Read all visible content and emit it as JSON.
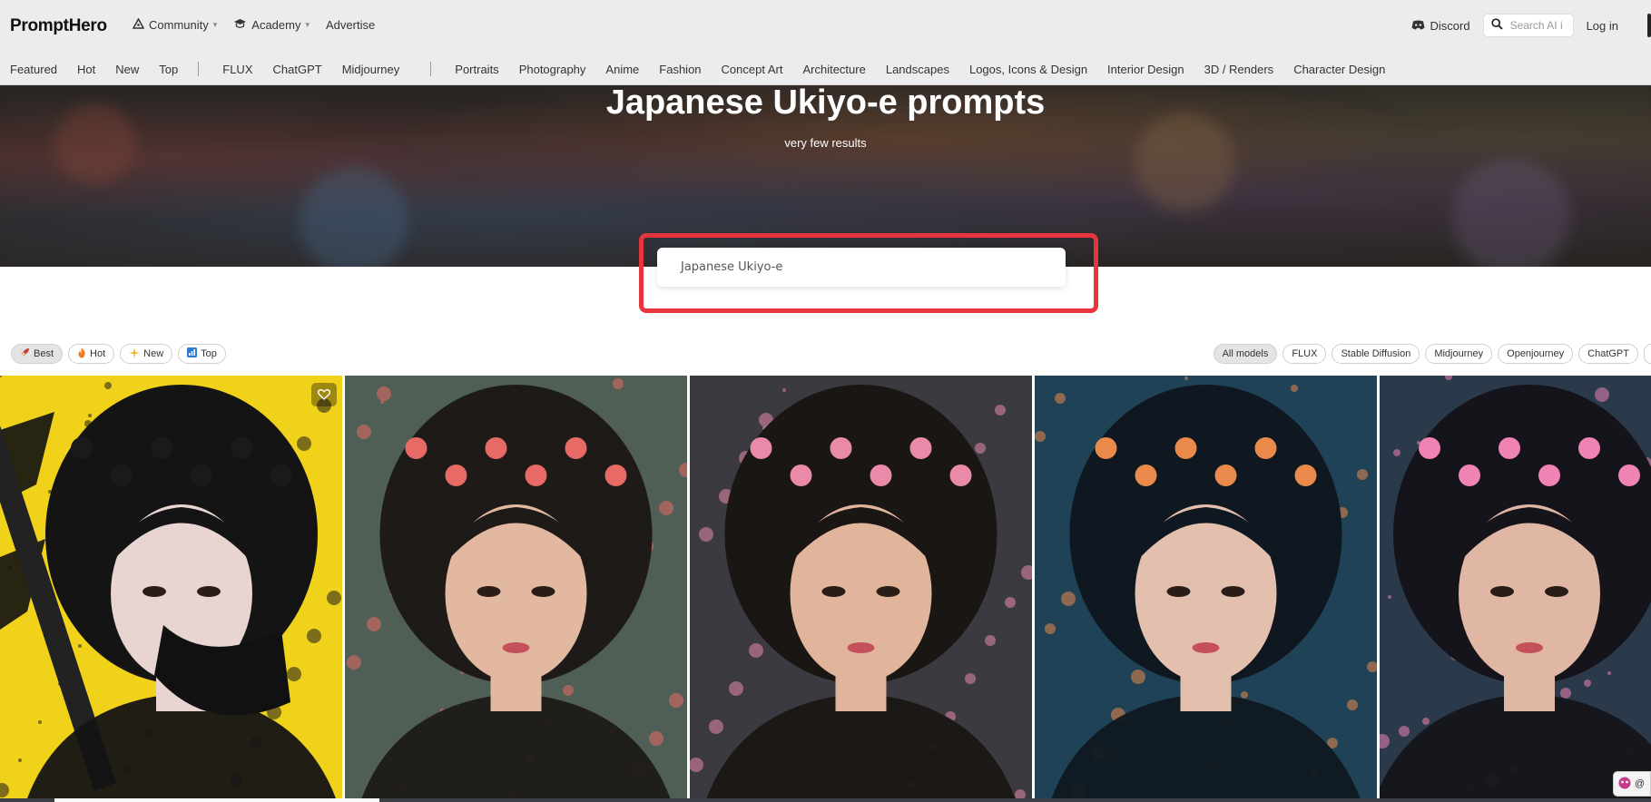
{
  "header": {
    "logo": "PromptHero",
    "nav": [
      {
        "label": "Community",
        "icon": "community-icon",
        "dropdown": true
      },
      {
        "label": "Academy",
        "icon": "graduation-cap-icon",
        "dropdown": true
      },
      {
        "label": "Advertise",
        "icon": "",
        "dropdown": false
      }
    ],
    "discord_label": "Discord",
    "search_placeholder": "Search AI i",
    "login_label": "Log in"
  },
  "categories_left": [
    "Featured",
    "Hot",
    "New",
    "Top"
  ],
  "categories_models": [
    "FLUX",
    "ChatGPT",
    "Midjourney"
  ],
  "categories_topics": [
    "Portraits",
    "Photography",
    "Anime",
    "Fashion",
    "Concept Art",
    "Architecture",
    "Landscapes",
    "Logos, Icons & Design",
    "Interior Design",
    "3D / Renders",
    "Character Design"
  ],
  "hero": {
    "title": "Japanese Ukiyo-e prompts",
    "subtitle": "very few results"
  },
  "search": {
    "value": "Japanese Ukiyo-e"
  },
  "sort_chips": [
    {
      "label": "Best",
      "icon": "rocket-icon",
      "active": true
    },
    {
      "label": "Hot",
      "icon": "fire-icon",
      "active": false
    },
    {
      "label": "New",
      "icon": "sparkle-icon",
      "active": false
    },
    {
      "label": "Top",
      "icon": "chart-icon",
      "active": false
    }
  ],
  "model_chips": [
    {
      "label": "All models",
      "active": true
    },
    {
      "label": "FLUX",
      "active": false
    },
    {
      "label": "Stable Diffusion",
      "active": false
    },
    {
      "label": "Midjourney",
      "active": false
    },
    {
      "label": "Openjourney",
      "active": false
    },
    {
      "label": "ChatGPT",
      "active": false
    }
  ],
  "gallery": [
    {
      "name": "gallery-image-ninja-woman",
      "bg": "#f1d21a",
      "hair": "#141414",
      "skin": "#e8d4d0",
      "accent": "#1a1a1a"
    },
    {
      "name": "gallery-image-geisha-roses",
      "bg": "#4f5f55",
      "hair": "#1e1a18",
      "skin": "#e3b8a0",
      "accent": "#e86a66"
    },
    {
      "name": "gallery-image-woman-lanterns",
      "bg": "#3a3a40",
      "hair": "#1a1614",
      "skin": "#e1b59c",
      "accent": "#e88aa8"
    },
    {
      "name": "gallery-image-woman-koi",
      "bg": "#1f4256",
      "hair": "#0f1820",
      "skin": "#e3c0ad",
      "accent": "#e98a4a"
    },
    {
      "name": "gallery-image-geisha-kimono",
      "bg": "#2b3a4a",
      "hair": "#15141a",
      "skin": "#e0b6a4",
      "accent": "#ef84b4"
    }
  ],
  "corner_badge": "@"
}
